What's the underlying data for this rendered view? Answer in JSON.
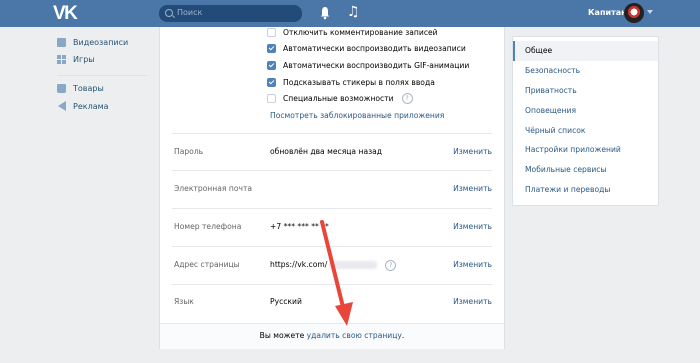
{
  "header": {
    "logo": "VK",
    "search_placeholder": "Поиск",
    "username": "Капитан"
  },
  "sidebar": {
    "items": [
      {
        "label": "Видеозаписи",
        "icon": "film-icon"
      },
      {
        "label": "Игры",
        "icon": "gamepad-icon"
      },
      {
        "label": "Товары",
        "icon": "bag-icon"
      },
      {
        "label": "Реклама",
        "icon": "megaphone-icon"
      }
    ]
  },
  "settings": {
    "checkboxes": [
      {
        "label": "Отключить комментирование записей",
        "checked": false
      },
      {
        "label": "Автоматически воспроизводить видеозаписи",
        "checked": true
      },
      {
        "label": "Автоматически воспроизводить GIF-анимации",
        "checked": true
      },
      {
        "label": "Подсказывать стикеры в полях ввода",
        "checked": true
      },
      {
        "label": "Специальные возможности",
        "checked": false,
        "help": "?"
      }
    ],
    "blocked_apps_link": "Посмотреть заблокированные приложения",
    "rows": [
      {
        "label": "Пароль",
        "value": "обновлён два месяца назад",
        "action": "Изменить"
      },
      {
        "label": "Электронная почта",
        "value": "",
        "action": "Изменить"
      },
      {
        "label": "Номер телефона",
        "value": "+7 *** *** ** **",
        "action": "Изменить"
      },
      {
        "label": "Адрес страницы",
        "value": "https://vk.com/",
        "action": "Изменить",
        "help": "?"
      },
      {
        "label": "Язык",
        "value": "Русский",
        "action": "Изменить"
      }
    ],
    "footer_text": "Вы можете ",
    "footer_link": "удалить свою страницу",
    "footer_end": "."
  },
  "right_menu": {
    "items": [
      {
        "label": "Общее",
        "active": true
      },
      {
        "label": "Безопасность"
      },
      {
        "label": "Приватность"
      },
      {
        "label": "Оповещения"
      },
      {
        "label": "Чёрный список"
      },
      {
        "label": "Настройки приложений"
      },
      {
        "label": "Мобильные сервисы"
      },
      {
        "label": "Платежи и переводы"
      }
    ]
  },
  "colors": {
    "header": "#4a76a8",
    "link": "#2a5885",
    "annotation_arrow": "#e8463b"
  }
}
